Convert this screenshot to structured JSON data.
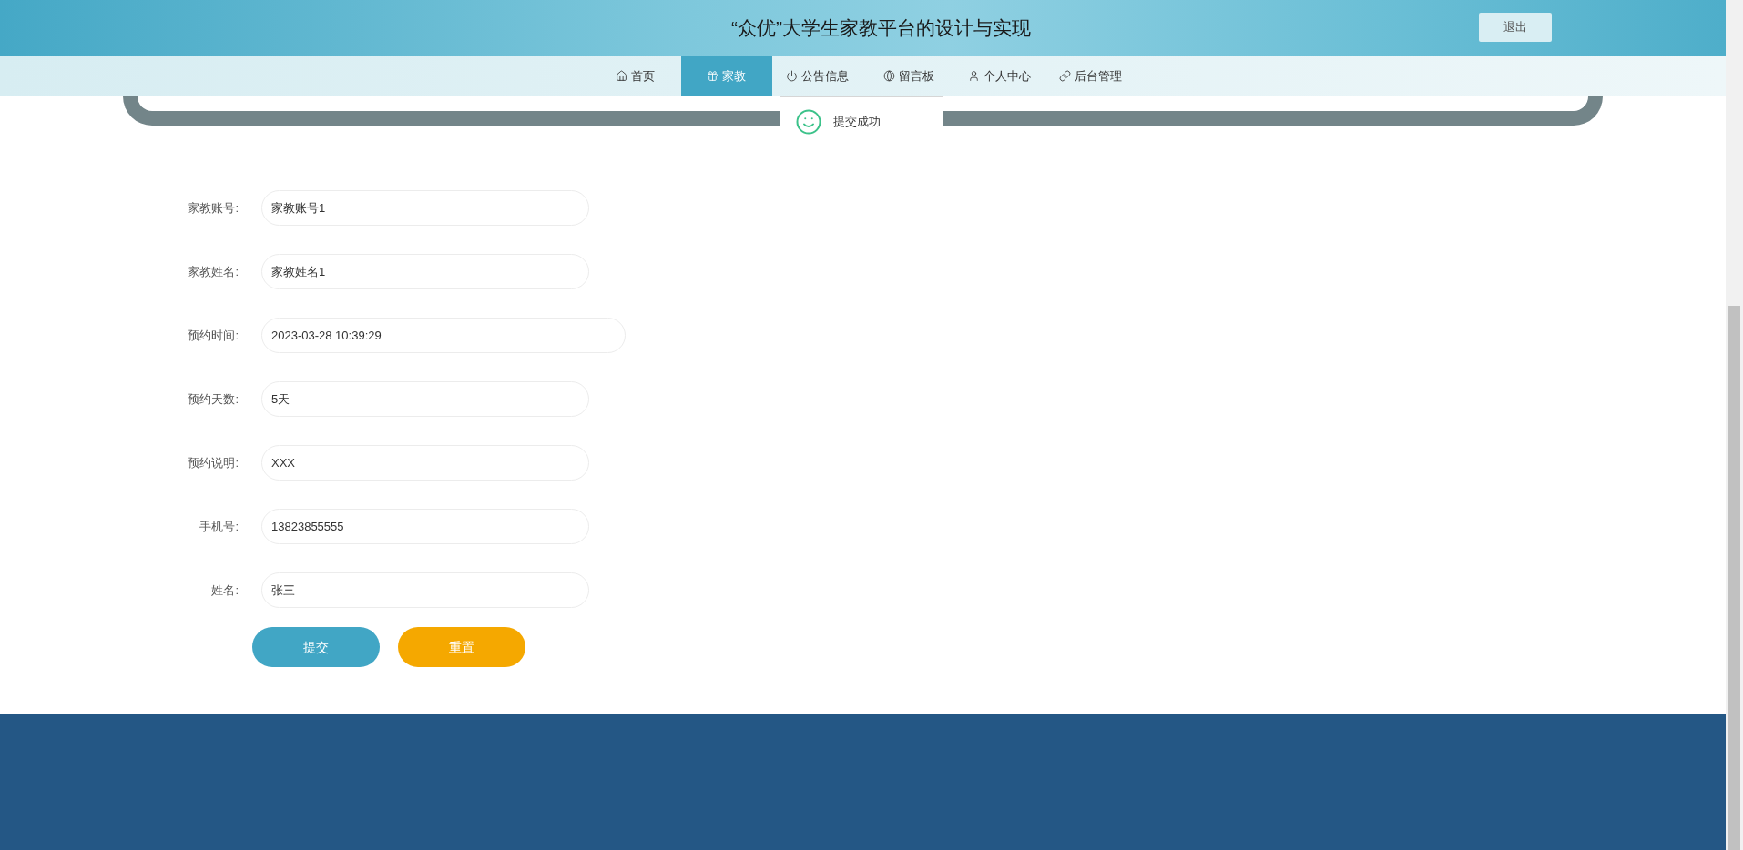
{
  "header": {
    "title": "“众优”大学生家教平台的设计与实现",
    "logout_button": "退出"
  },
  "nav": [
    {
      "label": "首页",
      "selected": false
    },
    {
      "label": "家教",
      "selected": true
    },
    {
      "label": "公告信息",
      "selected": false
    },
    {
      "label": "留言板",
      "selected": false
    },
    {
      "label": "个人中心",
      "selected": false
    },
    {
      "label": "后台管理",
      "selected": false
    }
  ],
  "toast": {
    "message": "提交成功"
  },
  "form": {
    "fields": [
      {
        "label": "家教账号:",
        "value": "家教账号1"
      },
      {
        "label": "家教姓名:",
        "value": "家教姓名1"
      },
      {
        "label": "预约时间:",
        "value": "2023-03-28 10:39:29"
      },
      {
        "label": "预约天数:",
        "value": "5天"
      },
      {
        "label": "预约说明:",
        "value": "XXX"
      },
      {
        "label": "手机号:",
        "value": "13823855555"
      },
      {
        "label": "姓名:",
        "value": "张三"
      }
    ],
    "buttons": [
      {
        "label": "提交",
        "kind": "primary"
      },
      {
        "label": "重置",
        "kind": "secondary"
      }
    ]
  }
}
